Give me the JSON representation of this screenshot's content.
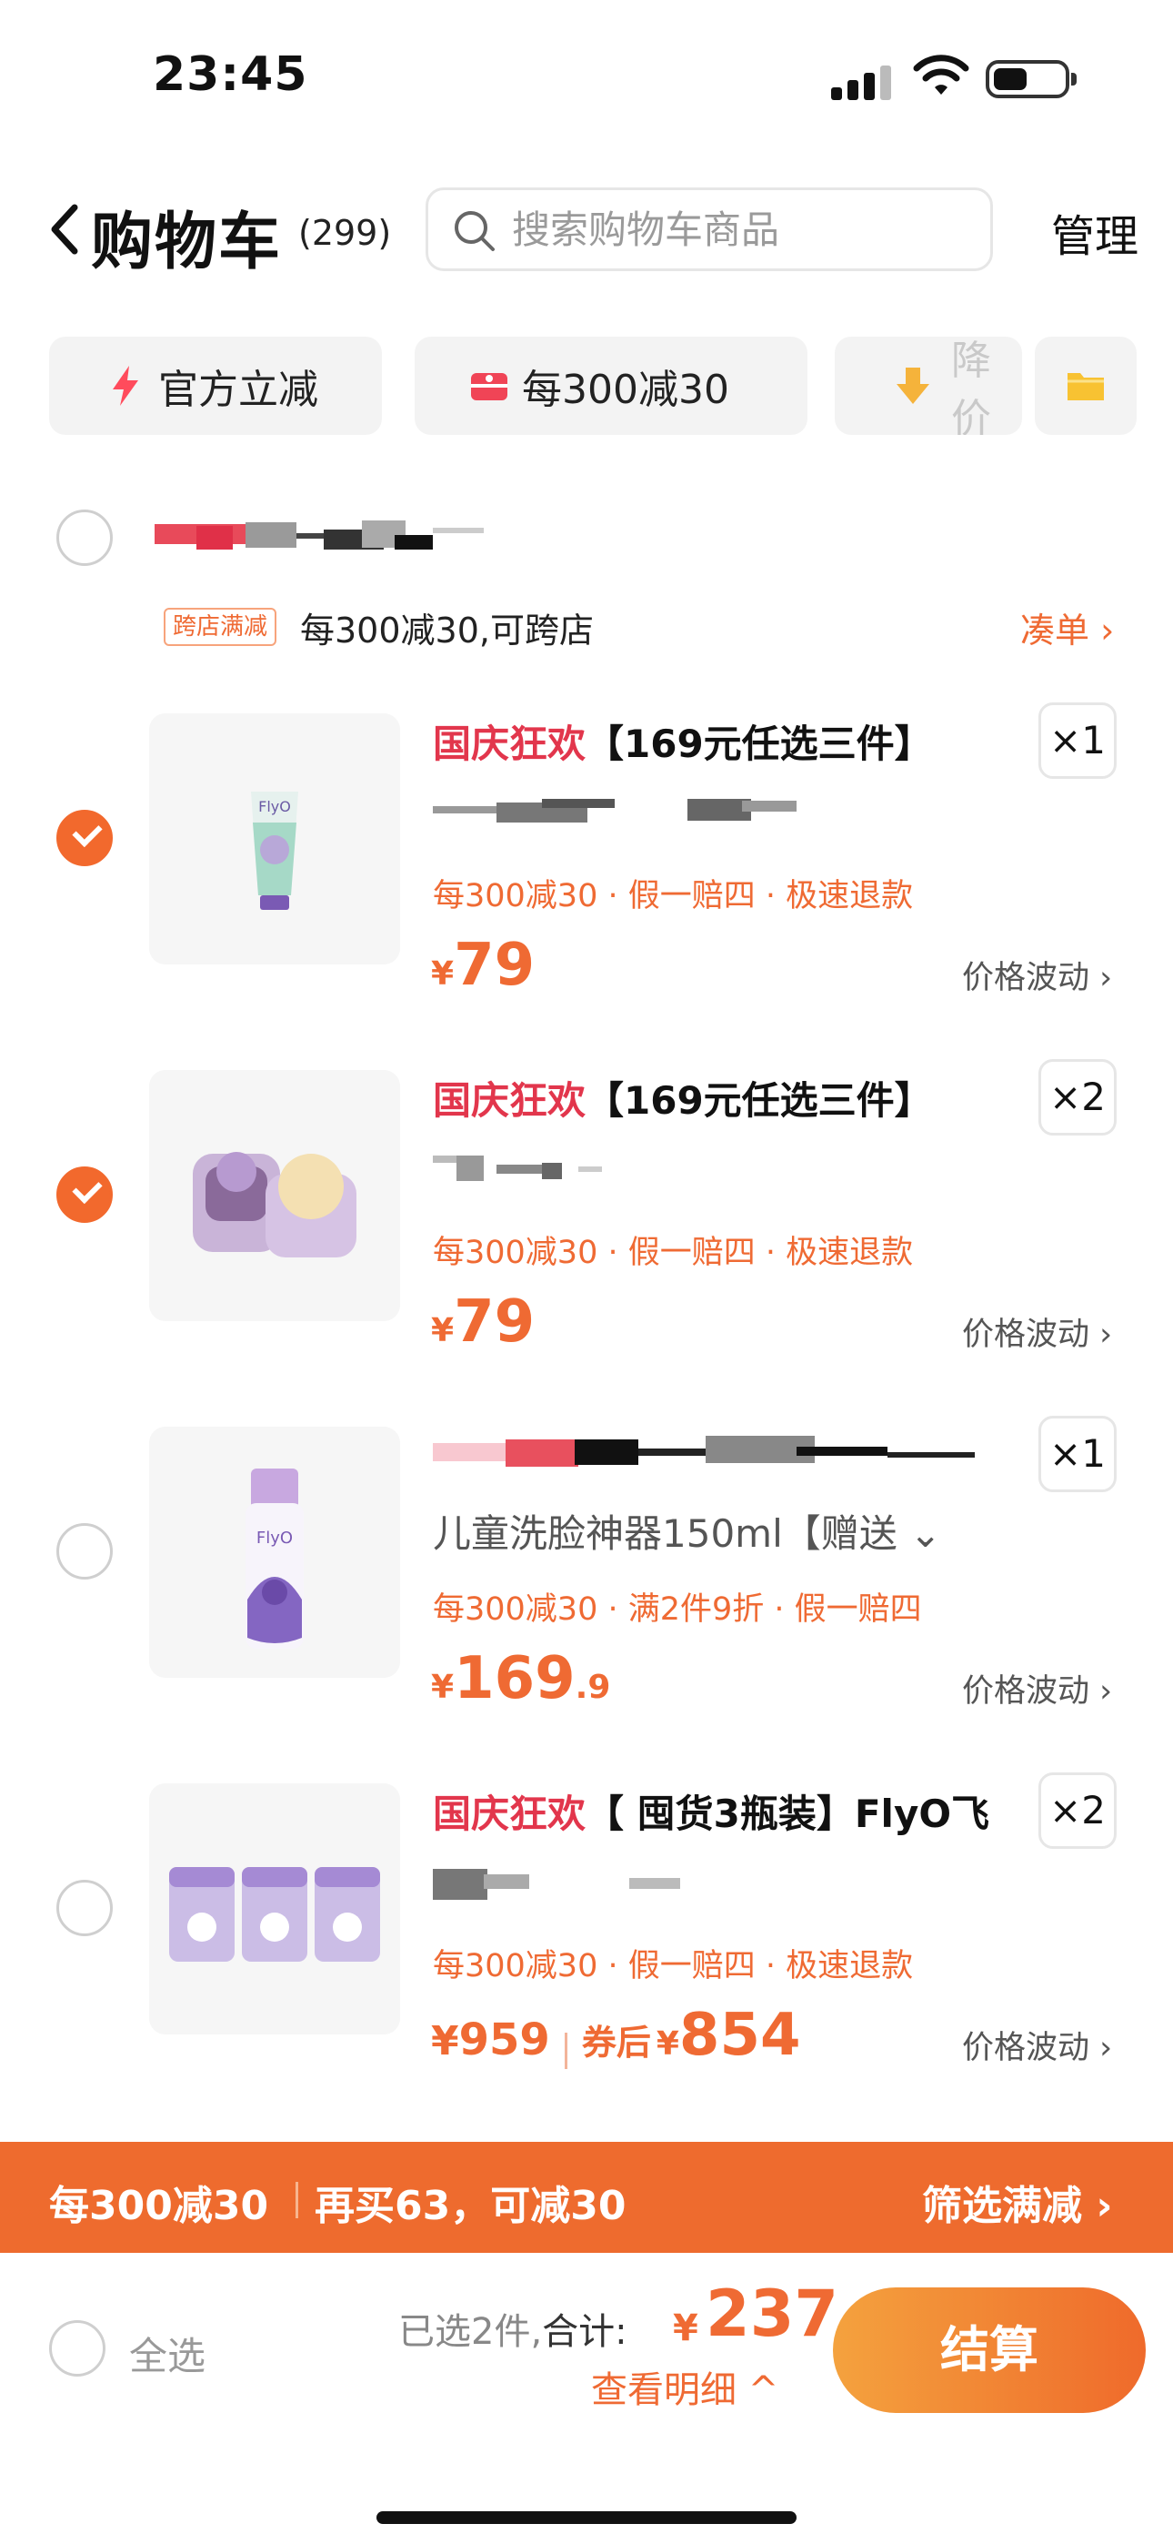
{
  "status_bar": {
    "time": "23:45"
  },
  "nav": {
    "title": "购物车",
    "count": "(299)",
    "search_placeholder": "搜索购物车商品",
    "manage": "管理"
  },
  "filters": [
    {
      "label": "官方立减",
      "icon": "lightning-icon"
    },
    {
      "label": "每300减30",
      "icon": "coupon-icon"
    },
    {
      "label": "降价",
      "icon": "price-drop-icon"
    },
    {
      "label": "",
      "icon": "folder-icon"
    }
  ],
  "store": {
    "tag": "跨店满减",
    "promo": "每300减30,可跨店",
    "action": "凑单 ›"
  },
  "items": [
    {
      "highlight": "国庆狂欢",
      "title": "【169元任选三件】",
      "qty": "×1",
      "sku": "",
      "features": "每300减30 · 假一赔四 · 极速退款",
      "price_yen": "¥",
      "price_int": "79",
      "price_dec": "",
      "fluctuation": "价格波动 ›",
      "selected": true
    },
    {
      "highlight": "国庆狂欢",
      "title": "【169元任选三件】",
      "qty": "×2",
      "sku": "",
      "features": "每300减30 · 假一赔四 · 极速退款",
      "price_yen": "¥",
      "price_int": "79",
      "price_dec": "",
      "fluctuation": "价格波动 ›",
      "selected": true
    },
    {
      "highlight": "",
      "title": "",
      "qty": "×1",
      "sku": "儿童洗脸神器150ml【赠送 ⌄",
      "features": "每300减30 · 满2件9折 · 假一赔四",
      "price_yen": "¥",
      "price_int": "169",
      "price_dec": ".9",
      "fluctuation": "价格波动 ›",
      "selected": false
    },
    {
      "highlight": "国庆狂欢",
      "title": "【 囤货3瓶装】FlyO飞",
      "qty": "×2",
      "sku": "",
      "features": "每300减30 · 假一赔四 · 极速退款",
      "price_yen": "¥",
      "price_int": "959",
      "coupon_label": "券后",
      "coupon_yen": "¥",
      "coupon_price": "854",
      "fluctuation": "价格波动 ›",
      "selected": false
    }
  ],
  "promo_bar": {
    "left": "每300减30",
    "middle": "再买63，可减30",
    "right": "筛选满减 ›"
  },
  "checkout": {
    "select_all": "全选",
    "selected_prefix": "已选2件,",
    "total_label": "合计:",
    "yen": "¥",
    "total": "237",
    "detail": "查看明细 ^",
    "button": "结算"
  },
  "colors": {
    "accent": "#ef6a33",
    "highlight": "#e2364c"
  }
}
